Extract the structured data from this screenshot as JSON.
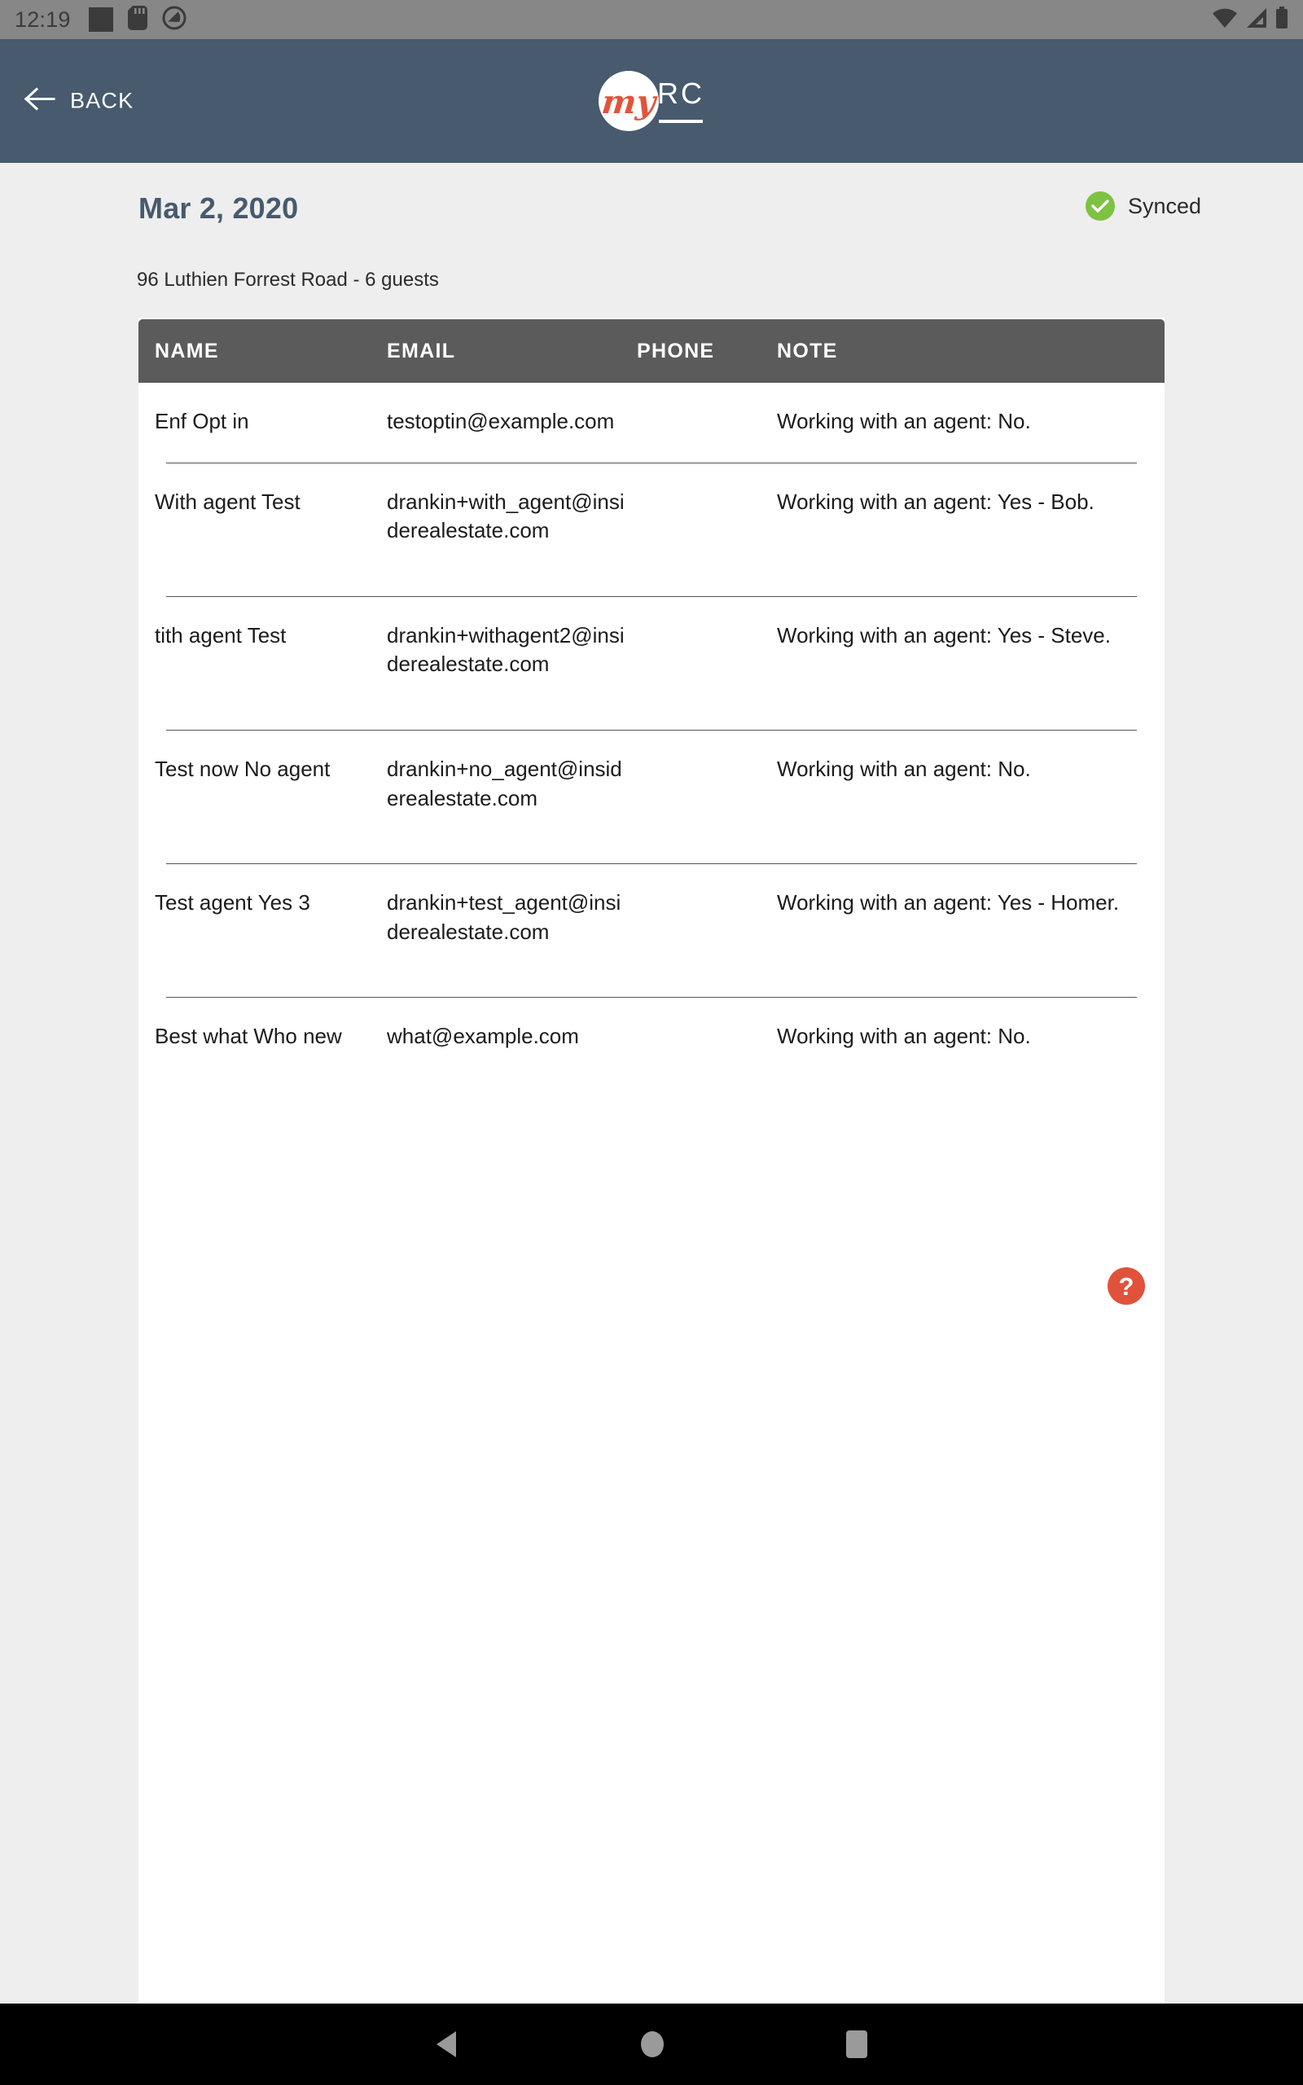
{
  "statusbar": {
    "clock": "12:19",
    "left_icons": [
      "square-icon",
      "sd-card-icon",
      "do-not-disturb-icon"
    ],
    "right_icons": [
      "wifi-icon",
      "cell-signal-icon",
      "battery-icon"
    ]
  },
  "appbar": {
    "back_label": "BACK",
    "logo": {
      "script_text": "my",
      "mark_text": "RC"
    },
    "background_color": "#475a6e"
  },
  "page": {
    "date_title": "Mar 2, 2020",
    "sync_label": "Synced",
    "sync_color": "#7dc242",
    "address_line": "96 Luthien Forrest Road - 6 guests"
  },
  "table": {
    "headers": [
      "NAME",
      "EMAIL",
      "PHONE",
      "NOTE"
    ],
    "header_bg": "#5b5b5b",
    "rows": [
      {
        "name": "Enf Opt in",
        "email": "testoptin@example.com",
        "phone": "",
        "note": "Working with an agent: No."
      },
      {
        "name": "With agent Test",
        "email": "drankin+with_agent@insiderealestate.com",
        "phone": "",
        "note": "Working with an agent: Yes - Bob."
      },
      {
        "name": "tith agent Test",
        "email": "drankin+withagent2@insiderealestate.com",
        "phone": "",
        "note": "Working with an agent: Yes - Steve."
      },
      {
        "name": "Test now No agent",
        "email": "drankin+no_agent@insiderealestate.com",
        "phone": "",
        "note": "Working with an agent: No."
      },
      {
        "name": "Test agent  Yes 3",
        "email": "drankin+test_agent@insiderealestate.com",
        "phone": "",
        "note": "Working with an agent: Yes - Homer."
      },
      {
        "name": "Best what Who new",
        "email": "what@example.com",
        "phone": "",
        "note": "Working with an agent: No."
      }
    ]
  },
  "help": {
    "label": "?",
    "color": "#e0523c"
  },
  "navbar": {
    "buttons": [
      "back-triangle-icon",
      "home-circle-icon",
      "recents-square-icon"
    ]
  }
}
